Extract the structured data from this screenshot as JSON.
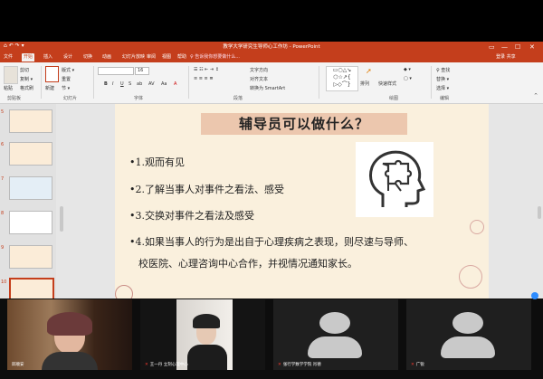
{
  "window": {
    "title": "教学大学研究生导师心工作坊 - PowerPoint",
    "quick_access": "⌂ ↶ ↷ ▾",
    "controls": [
      "▭",
      "—",
      "☐",
      "✕"
    ],
    "user": "登录  共享"
  },
  "tabs": [
    "文件",
    "开始",
    "插入",
    "设计",
    "切换",
    "动画",
    "幻灯片放映",
    "审阅",
    "视图",
    "帮助",
    "福昕"
  ],
  "active_tab_index": 1,
  "tell_me": "♀ 告诉我你想要做什么...",
  "ribbon": {
    "groups": [
      "剪贴板",
      "幻灯片",
      "字体",
      "段落",
      "绘图",
      "编辑"
    ],
    "clipboard": {
      "paste": "粘贴",
      "cut": "剪切",
      "copy": "复制 ▾",
      "format": "格式刷"
    },
    "slides": {
      "new": "新建",
      "layout": "版式 ▾",
      "reset": "重置",
      "section": "节 ▾"
    },
    "font": {
      "name": "",
      "size": "16",
      "styles": [
        "B",
        "I",
        "U",
        "S",
        "ab",
        "AV",
        "Aa",
        "A"
      ]
    },
    "paragraph": {
      "text_dir": "文字方向",
      "align_text": "对齐文本",
      "smartart": "转换为 SmartArt"
    },
    "drawing": {
      "arrange": "排列",
      "quick_styles": "快速样式"
    },
    "editing": {
      "find": "♀ 查找",
      "replace": "替换 ▾",
      "select": "选择 ▾"
    }
  },
  "thumbnails": [
    {
      "num": "5"
    },
    {
      "num": "6"
    },
    {
      "num": "7"
    },
    {
      "num": "8"
    },
    {
      "num": "9"
    },
    {
      "num": "10"
    }
  ],
  "slide": {
    "title": "辅导员可以做什么？",
    "bullets": [
      "•1.观而有见",
      "•2.了解当事人对事件之看法、感受",
      "•3.交换对事件之看法及感受",
      "•4.如果当事人的行为是出自于心理疾病之表现，则尽速与导师、",
      "校医院、心理咨询中心合作，并视情况通知家长。"
    ],
    "image_icon": "head-puzzle-icon"
  },
  "participants": [
    {
      "name": "邱顺安",
      "muted": false,
      "video": true
    },
    {
      "name": "王一丹 立刻心理中心",
      "muted": true,
      "video": true
    },
    {
      "name": "张行学数学学院 肖德",
      "muted": true,
      "video": false
    },
    {
      "name": "广锐",
      "muted": true,
      "video": false
    }
  ],
  "colors": {
    "accent": "#c43e1c",
    "slide_bg": "#faf0dd",
    "title_box": "#ecc7ae",
    "speaking": "#2ac74e"
  }
}
